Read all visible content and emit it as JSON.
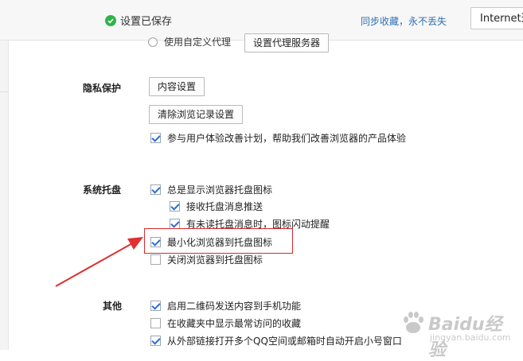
{
  "header": {
    "saved_text": "设置已保存",
    "sync_link": "同步收藏，永不丢失",
    "ie_button": "Internet选项"
  },
  "partial_row": {
    "text": "使用自定义代理",
    "button": "设置代理服务器"
  },
  "privacy": {
    "label": "隐私保护",
    "content_settings": "内容设置",
    "clear_history": "清除浏览记录设置",
    "experience_plan": {
      "label": "参与用户体验改善计划，帮助我们改善浏览器的产品体验",
      "checked": true
    }
  },
  "tray": {
    "label": "系统托盘",
    "items": [
      {
        "label": "总是显示浏览器托盘图标",
        "checked": true
      },
      {
        "label": "接收托盘消息推送",
        "checked": true
      },
      {
        "label": "有未读托盘消息时，图标闪动提醒",
        "checked": true
      },
      {
        "label": "最小化浏览器到托盘图标",
        "checked": true
      },
      {
        "label": "关闭浏览器到托盘图标",
        "checked": false
      }
    ]
  },
  "other": {
    "label": "其他",
    "items": [
      {
        "label": "启用二维码发送内容到手机功能",
        "checked": true
      },
      {
        "label": "在收藏夹中显示最常访问的收藏",
        "checked": false
      },
      {
        "label": "从外部链接打开多个QQ空间或邮箱时自动开启小号窗口",
        "checked": true
      }
    ]
  },
  "watermark": {
    "text": "Baidu经验",
    "url": "jingyan.baidu.com"
  },
  "colors": {
    "accent": "#2d6fcf",
    "highlight": "#d9282e",
    "success": "#2fb34a",
    "link": "#2f6fb3"
  }
}
